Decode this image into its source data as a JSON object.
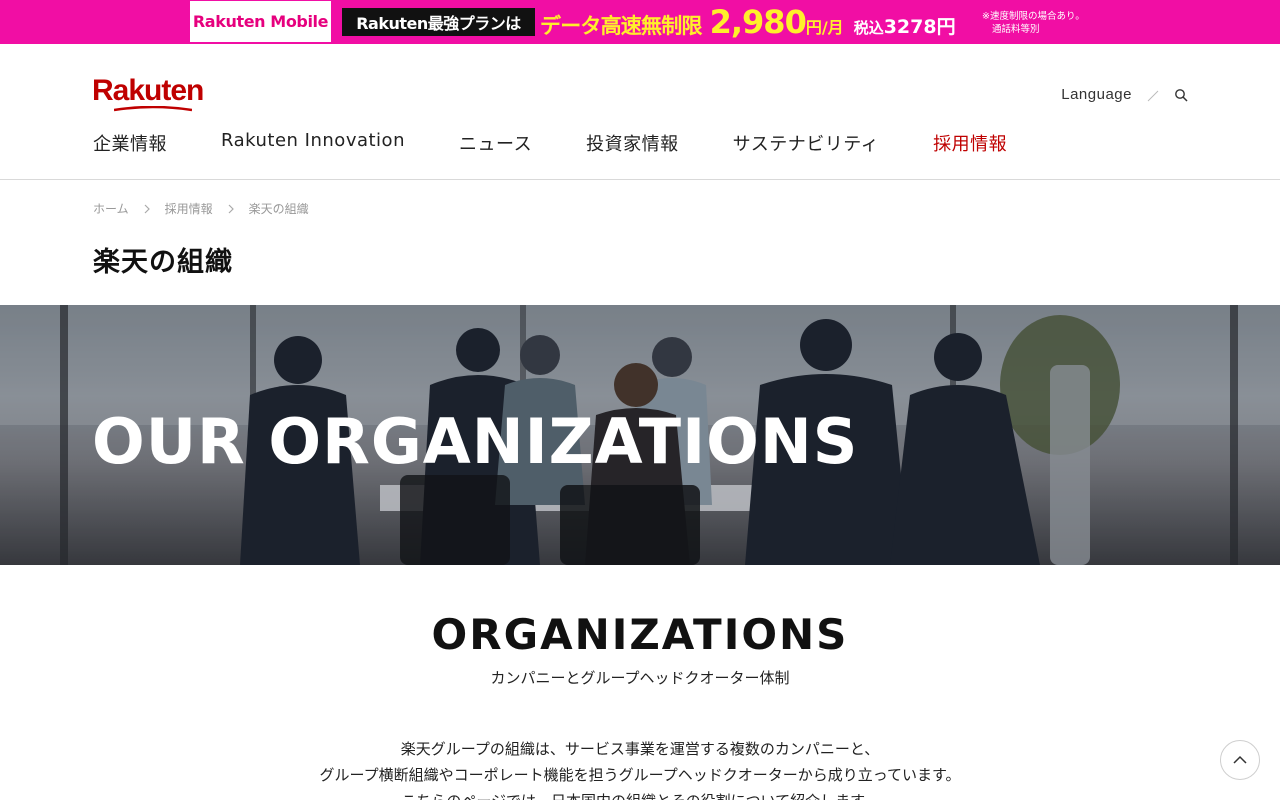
{
  "promo": {
    "brand": "Rakuten Mobile",
    "plan": "Rakuten最強プランは",
    "headline": "データ高速無制限",
    "price": "2,980",
    "price_unit": "円/月",
    "tax_label": "税込",
    "tax_price": "3278円",
    "note_line1": "※速度制限の場合あり。",
    "note_line2": "通話料等別",
    "colors": {
      "background": "#f10ea4",
      "highlight": "#ffef2b"
    }
  },
  "header": {
    "logo": "Rakuten",
    "language": "Language",
    "nav": [
      {
        "label": "企業情報",
        "active": false
      },
      {
        "label": "Rakuten Innovation",
        "active": false
      },
      {
        "label": "ニュース",
        "active": false
      },
      {
        "label": "投資家情報",
        "active": false
      },
      {
        "label": "サステナビリティ",
        "active": false
      },
      {
        "label": "採用情報",
        "active": true
      }
    ],
    "accent": "#bf0000"
  },
  "breadcrumb": [
    "ホーム",
    "採用情報",
    "楽天の組織"
  ],
  "page_title": "楽天の組織",
  "hero": {
    "title": "OUR ORGANIZATIONS"
  },
  "section": {
    "title": "ORGANIZATIONS",
    "subtitle": "カンパニーとグループヘッドクオーター体制",
    "body": [
      "楽天グループの組織は、サービス事業を運営する複数のカンパニーと、",
      "グループ横断組織やコーポレート機能を担うグループヘッドクオーターから成り立っています。",
      "こちらのページでは、日本国内の組織とその役割について紹介します。"
    ]
  },
  "icons": {
    "search": "search-icon",
    "to_top": "chevron-up-icon",
    "breadcrumb_sep": "chevron-right-icon"
  }
}
